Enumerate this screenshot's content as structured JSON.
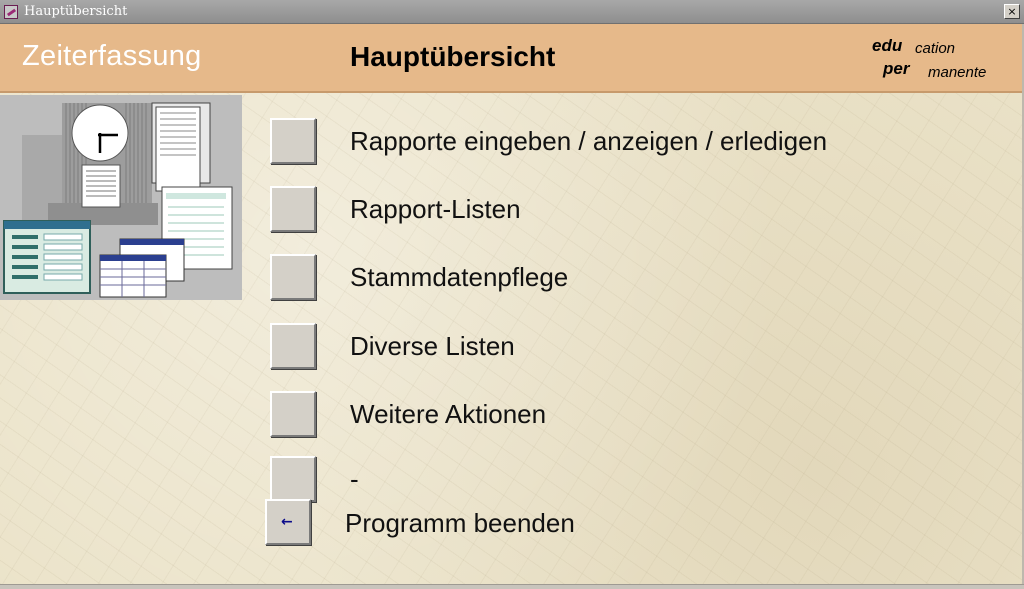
{
  "window": {
    "title": "Hauptübersicht",
    "close_glyph": "×"
  },
  "header": {
    "app_name": "Zeiterfassung",
    "page_title": "Hauptübersicht",
    "logo": {
      "line1_bold": "edu",
      "line1_small": "cation",
      "line2_bold": "per",
      "line2_small": "manente"
    }
  },
  "menu": {
    "items": [
      {
        "label": "Rapporte eingeben / anzeigen / erledigen"
      },
      {
        "label": "Rapport-Listen"
      },
      {
        "label": "Stammdatenpflege"
      },
      {
        "label": "Diverse Listen"
      },
      {
        "label": "Weitere Aktionen"
      },
      {
        "label": "-"
      }
    ],
    "exit": {
      "label": "Programm beenden",
      "icon": "arrow-left-icon",
      "glyph": "←"
    }
  },
  "colors": {
    "header_band": "#e6b98a",
    "form_background": "#ebe3c9",
    "button_face": "#d4d0c8"
  }
}
